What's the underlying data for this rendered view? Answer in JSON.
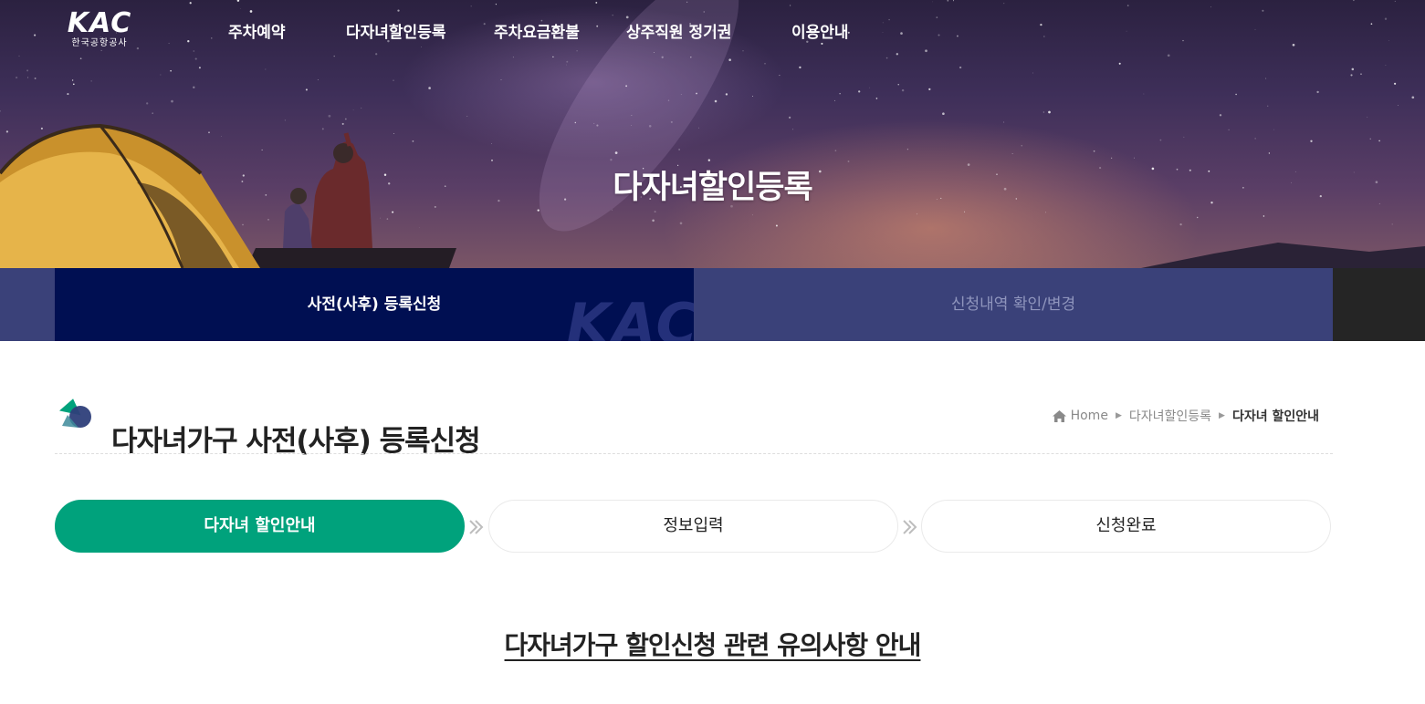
{
  "header": {
    "logo": {
      "mark": "KAC",
      "subtitle": "한국공항공사"
    },
    "nav": [
      {
        "label": "주차예약"
      },
      {
        "label": "다자녀할인등록"
      },
      {
        "label": "주차요금환불"
      },
      {
        "label": "상주직원 정기권"
      },
      {
        "label": "이용안내"
      }
    ]
  },
  "hero": {
    "title": "다자녀할인등록"
  },
  "tabs": [
    {
      "label": "사전(사후) 등록신청",
      "active": true,
      "watermark": "KAC"
    },
    {
      "label": "신청내역 확인/변경",
      "active": false
    }
  ],
  "page": {
    "title": "다자녀가구 사전(사후) 등록신청",
    "breadcrumb": [
      "Home",
      "다자녀할인등록",
      "다자녀 할인안내"
    ]
  },
  "steps": [
    {
      "label": "다자녀 할인안내",
      "active": true
    },
    {
      "label": "정보입력",
      "active": false
    },
    {
      "label": "신청완료",
      "active": false
    }
  ],
  "notice": {
    "title": "다자녀가구 할인신청 관련 유의사항 안내"
  },
  "colors": {
    "accent_green": "#00a27c",
    "tab_active": "#000f52",
    "tab_bar": "#3a4179"
  },
  "icons": {
    "home": "home-icon",
    "step_arrow": "double-chevron-right-icon",
    "title": "brand-shape-icon"
  }
}
